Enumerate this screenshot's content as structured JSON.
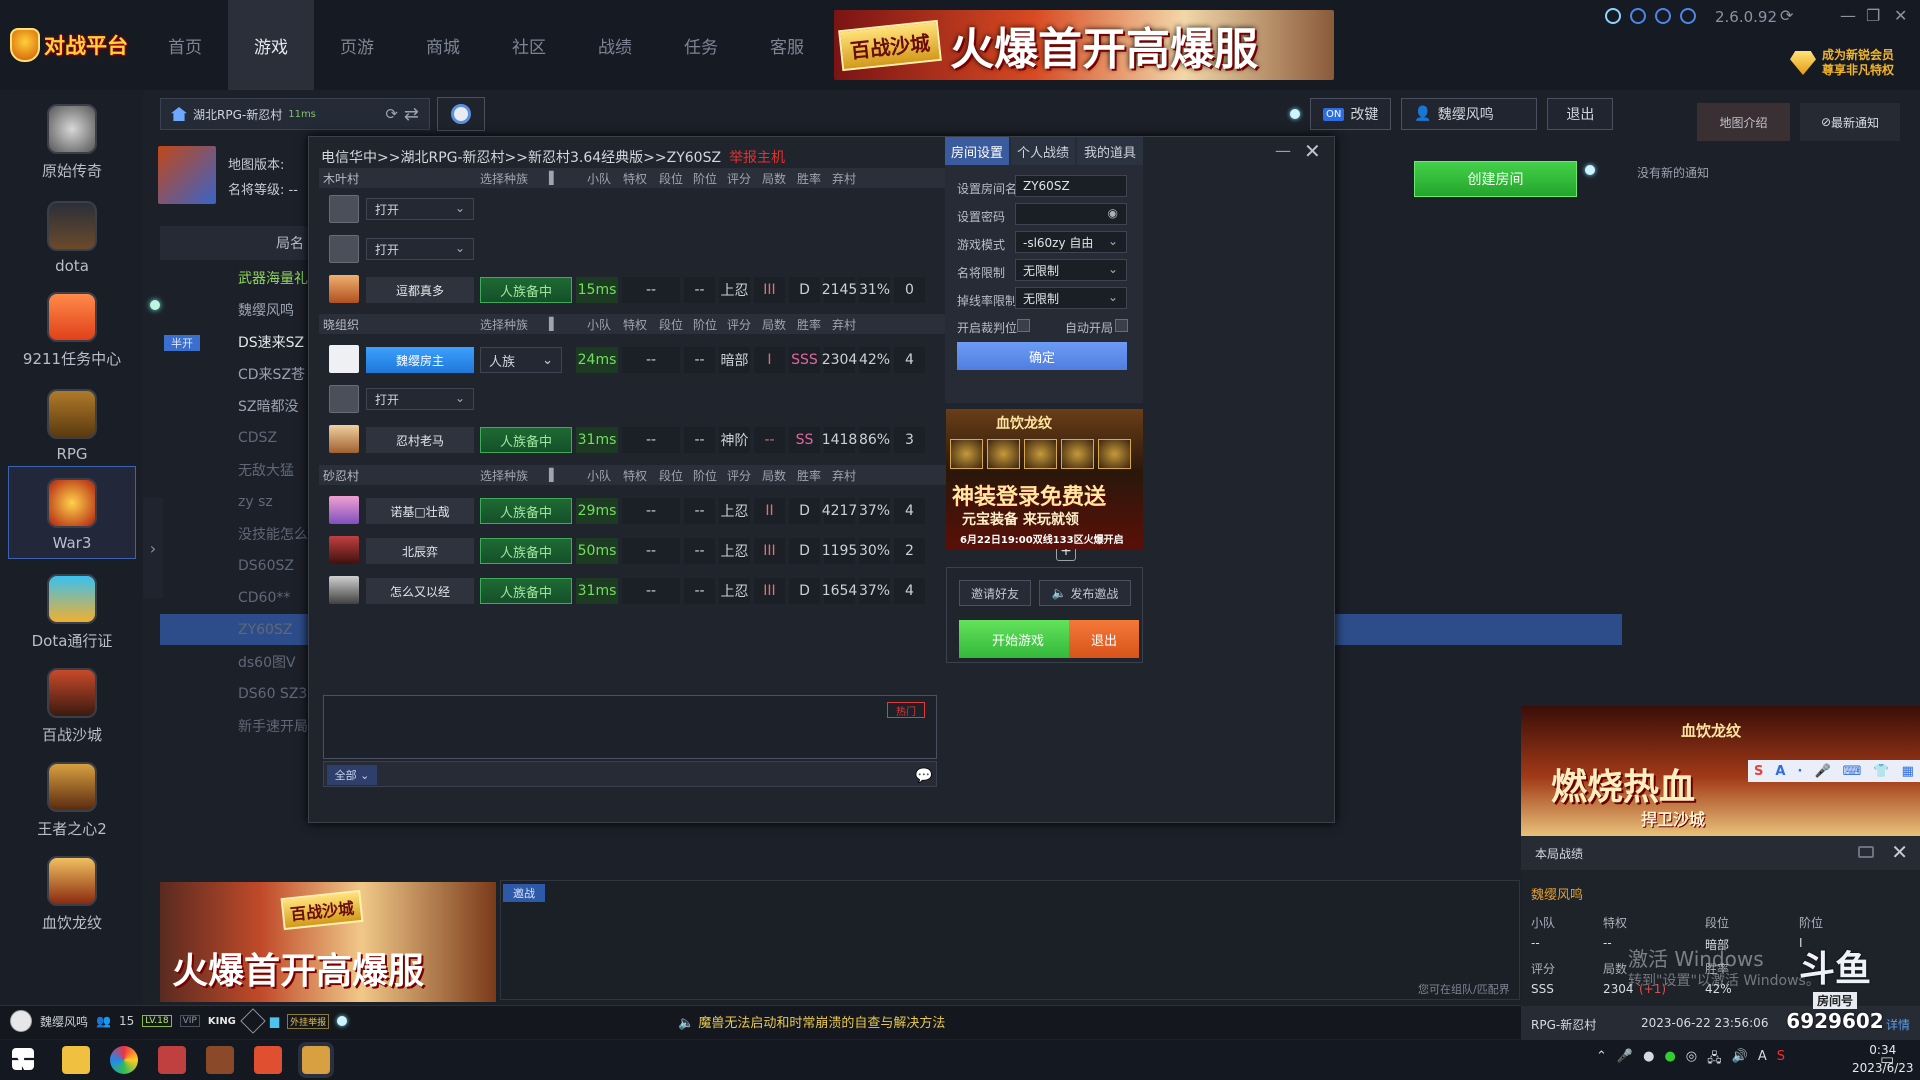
{
  "app": {
    "logo_text": "对战平台",
    "version": "2.6.0.92",
    "vip_line1": "成为新锐会员",
    "vip_line2": "尊享非凡特权"
  },
  "nav": [
    "首页",
    "游戏",
    "页游",
    "商城",
    "社区",
    "战绩",
    "任务",
    "客服"
  ],
  "top_banner": {
    "tag": "百战沙城",
    "text": "火爆首开高爆服"
  },
  "sidebar": [
    {
      "label": "原始传奇",
      "icon": "legend-icon"
    },
    {
      "label": "dota",
      "icon": "dota-icon"
    },
    {
      "label": "9211任务中心",
      "icon": "task-icon"
    },
    {
      "label": "RPG",
      "icon": "rpg-icon"
    },
    {
      "label": "War3",
      "icon": "war3-icon"
    },
    {
      "label": "Dota通行证",
      "icon": "pass-icon"
    },
    {
      "label": "百战沙城",
      "icon": "sand-city-icon"
    },
    {
      "label": "王者之心2",
      "icon": "king-heart-icon"
    },
    {
      "label": "血饮龙纹",
      "icon": "blood-dragon-icon"
    }
  ],
  "room_tab": {
    "name": "湖北RPG-新忍村",
    "latency": "11ms"
  },
  "game_info": {
    "map_version_label": "地图版本:",
    "rank_label": "名将等级:",
    "rank_value": "--"
  },
  "room_list": {
    "header": "局名",
    "half_badge": "半开",
    "items": [
      "武器海量礼",
      "魏缨风鸣",
      "DS速来SZ",
      "CD来SZ苍",
      "SZ暗都没",
      "CDSZ",
      "无敌大猛",
      "zy sz",
      "没技能怎么",
      "DS60SZ",
      "CD60**",
      "ZY60SZ",
      "ds60图V",
      "DS60 SZ3",
      "新手速开局"
    ]
  },
  "top_right": {
    "toggle_on": "ON",
    "toggle_label": "改键",
    "user": "魏缨风鸣",
    "logout": "退出"
  },
  "create_room": "创建房间",
  "right_panel": {
    "map_intro": "地图介绍",
    "latest_notice": "最新通知",
    "no_notice": "没有新的通知"
  },
  "dialog": {
    "title": "电信华中>>湖北RPG-新忍村>>新忍村3.64经典版>>ZY60SZ",
    "host_tag": "举报主机",
    "columns": [
      "选择种族",
      "小队",
      "特权",
      "段位",
      "阶位",
      "评分",
      "局数",
      "胜率",
      "弃村"
    ],
    "groups": [
      {
        "name": "木叶村",
        "rows": [
          {
            "type": "empty",
            "select": "打开"
          },
          {
            "type": "empty",
            "select": "打开"
          },
          {
            "type": "player",
            "name": "逗都真多",
            "race": "人族备中",
            "ping": "15ms",
            "team": "--",
            "priv": "--",
            "rank": "上忍",
            "tier": "III",
            "score": "D",
            "games": "2145",
            "winrate": "31%",
            "quit": "0",
            "action": "+"
          }
        ]
      },
      {
        "name": "晓组织",
        "rows": [
          {
            "type": "host",
            "name": "魏缨房主",
            "race": "人族",
            "ping": "24ms",
            "team": "--",
            "priv": "--",
            "rank": "暗部",
            "tier": "I",
            "score": "SSS",
            "games": "2304",
            "winrate": "42%",
            "quit": "4",
            "action": ""
          },
          {
            "type": "empty",
            "select": "打开"
          },
          {
            "type": "player",
            "name": "忍村老马",
            "race": "人族备中",
            "ping": "31ms",
            "team": "--",
            "priv": "--",
            "rank": "神阶",
            "tier": "--",
            "score": "SS",
            "games": "1418",
            "winrate": "86%",
            "quit": "3",
            "action": "…"
          }
        ]
      },
      {
        "name": "砂忍村",
        "rows": [
          {
            "type": "player",
            "name": "诺基□壮哉",
            "race": "人族备中",
            "ping": "29ms",
            "team": "--",
            "priv": "--",
            "rank": "上忍",
            "tier": "II",
            "score": "D",
            "games": "4217",
            "winrate": "37%",
            "quit": "4",
            "action": "…"
          },
          {
            "type": "player",
            "name": "北辰弈",
            "race": "人族备中",
            "ping": "50ms",
            "team": "--",
            "priv": "--",
            "rank": "上忍",
            "tier": "III",
            "score": "D",
            "games": "1195",
            "winrate": "30%",
            "quit": "2",
            "action": "+"
          },
          {
            "type": "player",
            "name": "怎么又以经",
            "race": "人族备中",
            "ping": "31ms",
            "team": "--",
            "priv": "--",
            "rank": "上忍",
            "tier": "III",
            "score": "D",
            "games": "1654",
            "winrate": "37%",
            "quit": "4",
            "action": "…"
          }
        ]
      }
    ],
    "chat": {
      "hot": "热门",
      "filter": "全部"
    },
    "tabs": [
      "房间设置",
      "个人战绩",
      "我的道具"
    ],
    "settings": {
      "room_name_label": "设置房间名",
      "room_name": "ZY60SZ",
      "password_label": "设置密码",
      "mode_label": "游戏模式",
      "mode": "-sl60zy 自由",
      "rank_label": "名将限制",
      "rank": "无限制",
      "drop_label": "掉线率限制",
      "drop": "无限制",
      "referee_label": "开启裁判位",
      "auto_label": "自动开局",
      "confirm": "确定"
    },
    "ad": {
      "title": "血饮龙纹",
      "line1": "神装登录免费送",
      "line2": "元宝装备 来玩就领",
      "line3": "6月22日19:00双线133区火爆开启"
    },
    "actions": {
      "invite": "邀请好友",
      "broadcast": "发布邀战",
      "start": "开始游戏",
      "exit": "退出"
    }
  },
  "bottom_banner": {
    "tag": "百战沙城",
    "text": "火爆首开高爆服"
  },
  "invite": {
    "tag": "邀战",
    "hint": "您可在组队/匹配界"
  },
  "status": {
    "user": "魏缨风鸣",
    "friends": "15",
    "lv": "LV.18",
    "vip": "VIP",
    "king": "KING",
    "ext": "外挂举报",
    "notice": "魔兽无法启动和时常崩溃的自查与解决方法"
  },
  "stream_ad": {
    "title": "血饮龙纹",
    "headline": "燃烧热血",
    "sub": "捍卫沙城"
  },
  "match_panel": {
    "title": "本局战绩",
    "player": "魏缨风鸣",
    "labels": [
      "小队",
      "特权",
      "段位",
      "阶位",
      "评分",
      "局数",
      "胜率"
    ],
    "values": {
      "team": "--",
      "priv": "--",
      "rank": "暗部",
      "tier": "I",
      "score": "SSS",
      "games": "2304",
      "winrate": "42%",
      "delta": "(+1)"
    },
    "room": "RPG-新忍村",
    "time": "2023-06-22 23:56:06",
    "detail": "详情"
  },
  "watermark": {
    "line1": "激活 Windows",
    "line2": "转到\"设置\"以激活 Windows。"
  },
  "douyu": {
    "logo": "斗鱼",
    "room_label": "房间号",
    "room_no": "6929602"
  },
  "clock": {
    "time": "0:34",
    "date": "2023/6/23"
  },
  "colors": {
    "accent": "#3a63b0",
    "green": "#33b83a",
    "orange": "#d8541b",
    "host_red": "#e53030"
  }
}
